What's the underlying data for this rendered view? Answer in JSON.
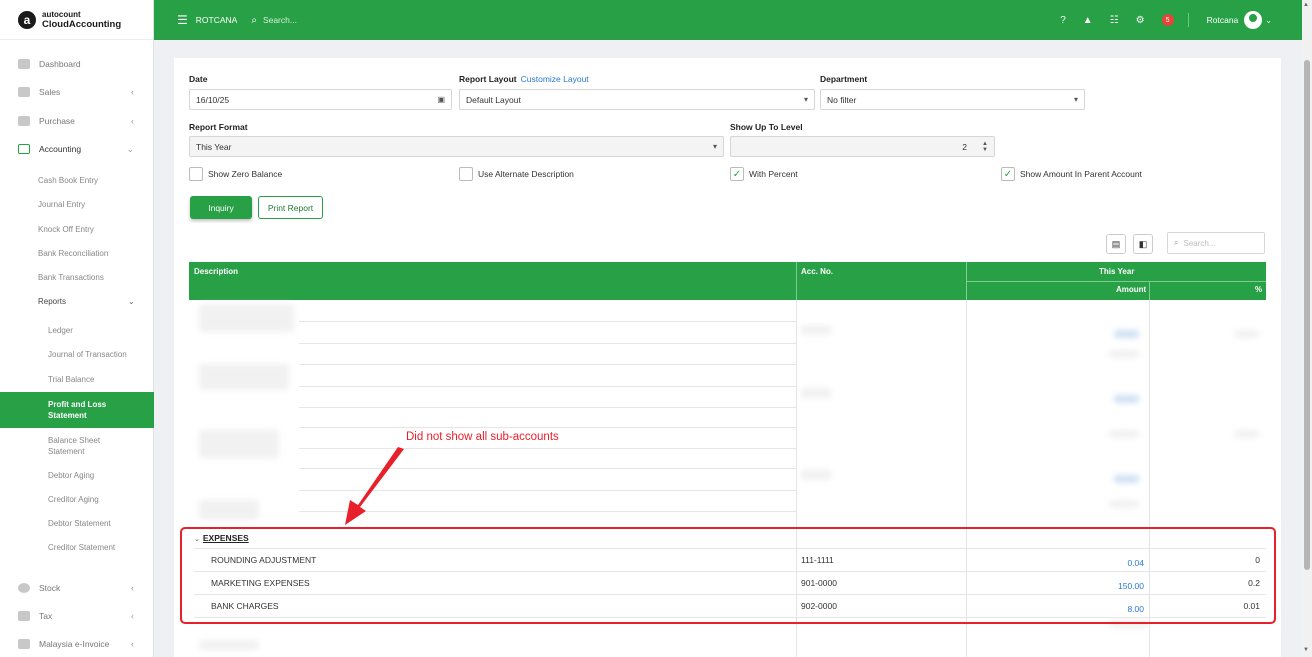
{
  "app": {
    "logo_letter": "a",
    "logo_top": "autocount",
    "logo_bottom": "CloudAccounting"
  },
  "topbar": {
    "company": "ROTCANA",
    "search_placeholder": "Search...",
    "notification_count": "5",
    "user_name": "Rotcana"
  },
  "sidebar": {
    "items": [
      {
        "label": "Dashboard",
        "chevron": ""
      },
      {
        "label": "Sales",
        "chevron": "‹"
      },
      {
        "label": "Purchase",
        "chevron": "‹"
      },
      {
        "label": "Accounting",
        "chevron": "⌄"
      },
      {
        "label": "Stock",
        "chevron": "‹"
      },
      {
        "label": "Tax",
        "chevron": "‹"
      },
      {
        "label": "Malaysia e-Invoice",
        "chevron": "‹"
      }
    ],
    "accounting_sub": [
      "Cash Book Entry",
      "Journal Entry",
      "Knock Off Entry",
      "Bank Reconciliation",
      "Bank Transactions",
      "Reports"
    ],
    "reports_sub": [
      "Ledger",
      "Journal of Transaction",
      "Trial Balance",
      "Profit and Loss Statement",
      "Balance Sheet Statement",
      "Debtor Aging",
      "Creditor Aging",
      "Debtor Statement",
      "Creditor Statement"
    ],
    "active_item": "Profit and Loss Statement"
  },
  "form": {
    "date_label": "Date",
    "date_value": "16/10/25",
    "report_layout_label": "Report Layout",
    "customize_layout_link": "Customize Layout",
    "report_layout_value": "Default Layout",
    "department_label": "Department",
    "department_value": "No filter",
    "report_format_label": "Report Format",
    "report_format_value": "This Year",
    "show_up_to_level_label": "Show Up To Level",
    "show_up_to_level_value": "2",
    "checkboxes": [
      {
        "label": "Show Zero Balance",
        "checked": false
      },
      {
        "label": "Use Alternate Description",
        "checked": false
      },
      {
        "label": "With Percent",
        "checked": true
      },
      {
        "label": "Show Amount In Parent Account",
        "checked": true
      }
    ],
    "inquiry_button": "Inquiry",
    "print_button": "Print Report",
    "table_search_placeholder": "Search..."
  },
  "table": {
    "headers": {
      "description": "Description",
      "acc_no": "Acc. No.",
      "period": "This Year",
      "amount": "Amount",
      "percent": "%"
    },
    "section_label": "EXPENSES",
    "rows": [
      {
        "description": "ROUNDING ADJUSTMENT",
        "acc_no": "111-1111",
        "amount": "0.04",
        "percent": "0"
      },
      {
        "description": "MARKETING EXPENSES",
        "acc_no": "901-0000",
        "amount": "150.00",
        "percent": "0.2"
      },
      {
        "description": "BANK CHARGES",
        "acc_no": "902-0000",
        "amount": "8.00",
        "percent": "0.01"
      }
    ]
  },
  "annotation": {
    "text": "Did not show all sub-accounts"
  },
  "colors": {
    "brand_green": "#27a046",
    "annotation_red": "#e8202a",
    "link_blue": "#2a7ad2"
  }
}
